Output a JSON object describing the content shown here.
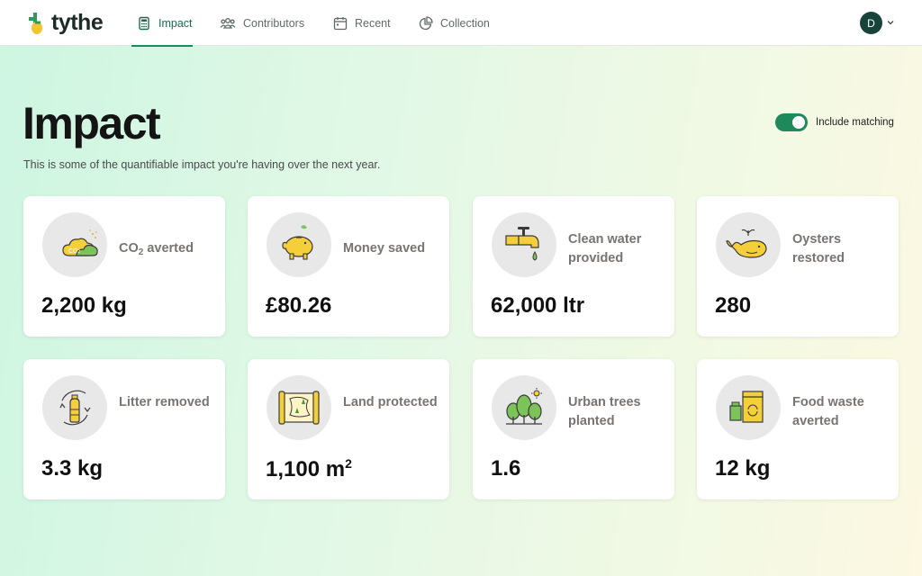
{
  "brand": {
    "name": "tythe"
  },
  "nav": {
    "tabs": [
      {
        "label": "Impact",
        "icon": "calculator-icon",
        "active": true
      },
      {
        "label": "Contributors",
        "icon": "people-icon"
      },
      {
        "label": "Recent",
        "icon": "calendar-icon"
      },
      {
        "label": "Collection",
        "icon": "pie-chart-icon"
      }
    ],
    "avatar_initial": "D"
  },
  "page": {
    "title": "Impact",
    "subtitle": "This is some of the quantifiable impact you're having over the next year.",
    "toggle_label": "Include matching",
    "toggle_on": true
  },
  "colors": {
    "accent": "#1e8a5c",
    "icon_yellow": "#f5cf3a",
    "icon_green": "#7cc35a"
  },
  "cards": [
    {
      "label_main": "CO",
      "label_sub": "2",
      "label_rest": " averted",
      "value": "2,200 kg",
      "icon": "co2-cloud-icon"
    },
    {
      "label": "Money saved",
      "value": "£80.26",
      "icon": "piggy-bank-icon"
    },
    {
      "label": "Clean water provided",
      "value": "62,000 ltr",
      "icon": "water-tap-icon"
    },
    {
      "label": "Oysters restored",
      "value": "280",
      "icon": "whale-icon"
    },
    {
      "label": "Litter removed",
      "value": "3.3 kg",
      "icon": "recycle-bottle-icon"
    },
    {
      "label": "Land protected",
      "value_main": "1,100 m",
      "value_sup": "2",
      "icon": "map-icon"
    },
    {
      "label": "Urban trees planted",
      "value": "1.6",
      "icon": "trees-icon"
    },
    {
      "label": "Food waste averted",
      "value": "12 kg",
      "icon": "food-bag-icon"
    }
  ]
}
